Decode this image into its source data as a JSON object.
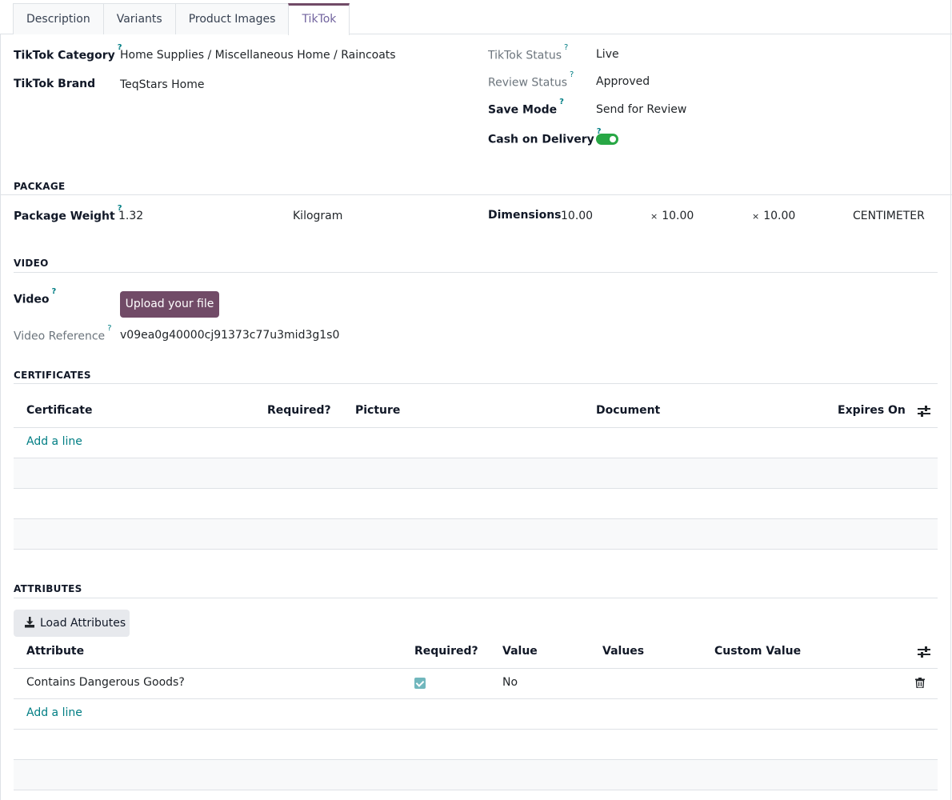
{
  "tabs": [
    {
      "label": "Description"
    },
    {
      "label": "Variants"
    },
    {
      "label": "Product Images"
    },
    {
      "label": "TikTok",
      "active": true
    }
  ],
  "fields": {
    "tiktok_category": {
      "label": "TikTok Category",
      "value": "Home Supplies / Miscellaneous Home / Raincoats"
    },
    "tiktok_brand": {
      "label": "TikTok Brand",
      "value": "TeqStars Home"
    },
    "tiktok_status": {
      "label": "TikTok Status",
      "value": "Live"
    },
    "review_status": {
      "label": "Review Status",
      "value": "Approved"
    },
    "save_mode": {
      "label": "Save Mode",
      "value": "Send for Review"
    },
    "cash_on_delivery": {
      "label": "Cash on Delivery",
      "value": true
    }
  },
  "help_mark": "?",
  "package": {
    "title": "PACKAGE",
    "weight_label": "Package Weight",
    "weight_value": "1.32",
    "weight_unit": "Kilogram",
    "dimensions_label": "Dimensions",
    "length": "10.00",
    "width": "10.00",
    "height": "10.00",
    "times": "×",
    "dimension_unit": "CENTIMETER"
  },
  "video": {
    "title": "VIDEO",
    "label": "Video",
    "upload_button": "Upload your file",
    "reference_label": "Video Reference",
    "reference_value": "v09ea0g40000cj91373c77u3mid3g1s0"
  },
  "certificates": {
    "title": "CERTIFICATES",
    "columns": [
      "Certificate",
      "Required?",
      "Picture",
      "Document",
      "Expires On"
    ],
    "add_line": "Add a line"
  },
  "attributes": {
    "title": "ATTRIBUTES",
    "load_button": "Load Attributes",
    "columns": [
      "Attribute",
      "Required?",
      "Value",
      "Values",
      "Custom Value"
    ],
    "rows": [
      {
        "attribute": "Contains Dangerous Goods?",
        "required": true,
        "value": "No",
        "values": "",
        "custom_value": ""
      }
    ],
    "add_line": "Add a line"
  },
  "colors": {
    "primary": "#714b67",
    "link": "#017e84",
    "toggle_on": "#28a745"
  }
}
